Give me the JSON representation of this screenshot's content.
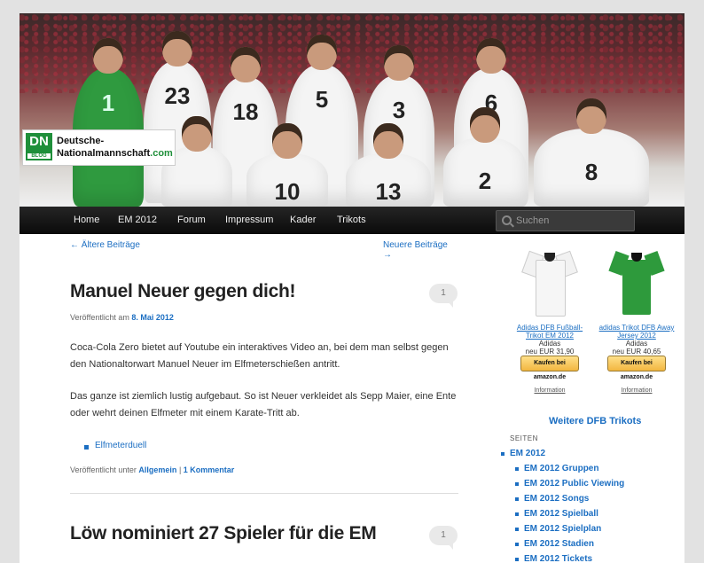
{
  "header": {
    "logo_dn": "DN",
    "logo_blog": "BLOG",
    "logo_line1": "Deutsche-",
    "logo_line2": "Nationalmannschaft",
    "logo_tld": ".com",
    "jersey_numbers": [
      "1",
      "23",
      "18",
      "5",
      "3",
      "6",
      "10",
      "13",
      "2",
      "8"
    ]
  },
  "nav": {
    "items": [
      "Home",
      "EM 2012",
      "Forum",
      "Impressum",
      "Kader",
      "Trikots"
    ],
    "search_placeholder": "Suchen"
  },
  "content": {
    "older": "← Ältere Beiträge",
    "newer": "Neuere Beiträge →",
    "post1": {
      "title": "Manuel Neuer gegen dich!",
      "comments": "1",
      "meta_prefix": "Veröffentlicht am",
      "date": "8. Mai 2012",
      "p1": "Coca-Cola Zero bietet auf Youtube ein interaktives Video an, bei dem man selbst gegen den Nationaltorwart Manuel Neuer im Elfmeterschießen antritt.",
      "p2": "Das ganze ist ziemlich lustig aufgebaut. So ist Neuer verkleidet als Sepp Maier, eine Ente oder wehrt deinen Elfmeter mit einem Karate-Tritt ab.",
      "tag": "Elfmeterduell",
      "footer_prefix": "Veröffentlicht unter",
      "category": "Allgemein",
      "separator": "|",
      "comments_link": "1 Kommentar"
    },
    "post2": {
      "title": "Löw nominiert 27 Spieler für die EM",
      "comments": "1"
    }
  },
  "sidebar": {
    "products": [
      {
        "name": "Adidas DFB Fußball-Trikot EM 2012",
        "brand": "Adidas",
        "price": "neu EUR 31,90",
        "button": "Kaufen bei amazon.de",
        "info": "Information",
        "color": "#f4f4f4"
      },
      {
        "name": "adidas Trikot DFB Away Jersey 2012",
        "brand": "Adidas",
        "price": "neu EUR 40,65",
        "button": "Kaufen bei amazon.de",
        "info": "Information",
        "color": "#2e9a3c"
      }
    ],
    "more": "Weitere DFB Trikots",
    "seiten_heading": "SEITEN",
    "pages": [
      "EM 2012",
      "EM 2012 Gruppen",
      "EM 2012 Public Viewing",
      "EM 2012 Songs",
      "EM 2012 Spielball",
      "EM 2012 Spielplan",
      "EM 2012 Stadien",
      "EM 2012 Tickets"
    ]
  }
}
